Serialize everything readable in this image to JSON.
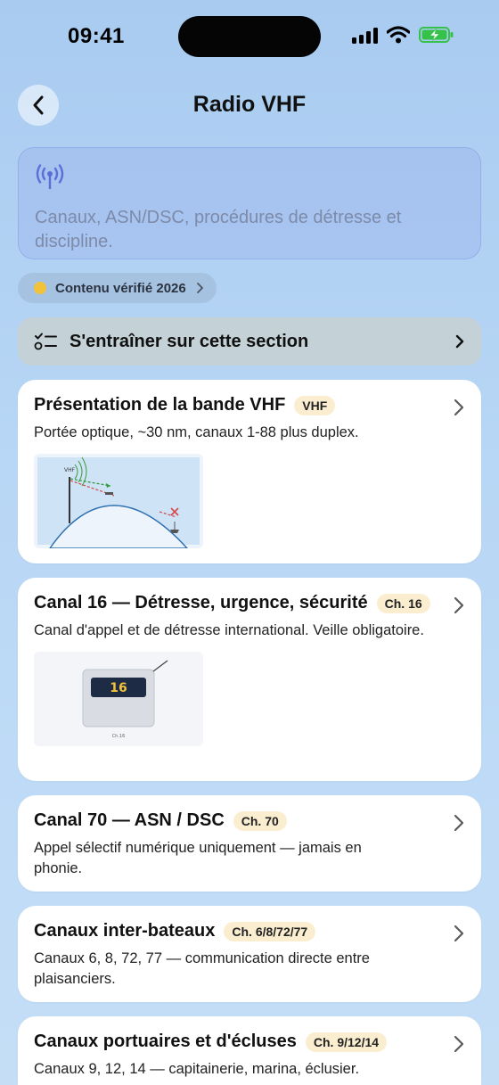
{
  "status": {
    "time": "09:41"
  },
  "nav": {
    "title": "Radio VHF"
  },
  "intro": {
    "icon": "antenna-radiowaves-icon",
    "text": "Canaux, ASN/DSC, procédures de détresse et discipline."
  },
  "verified": {
    "label": "Contenu vérifié 2026"
  },
  "train": {
    "label": "S'entraîner sur cette section"
  },
  "cards": [
    {
      "title": "Présentation de la bande VHF",
      "badge": "VHF",
      "desc": "Portée optique, ~30 nm, canaux 1-88 plus duplex.",
      "thumb": {
        "label": "VHF"
      }
    },
    {
      "title": "Canal 16 — Détresse, urgence, sécurité",
      "badge": "Ch. 16",
      "desc": "Canal d'appel et de détresse international. Veille obligatoire.",
      "thumb": {
        "display": "16",
        "caption": "Ch.16"
      }
    },
    {
      "title": "Canal 70 — ASN / DSC",
      "badge": "Ch. 70",
      "desc": "Appel sélectif numérique uniquement — jamais en phonie."
    },
    {
      "title": "Canaux inter-bateaux",
      "badge": "Ch. 6/8/72/77",
      "desc": "Canaux 6, 8, 72, 77 — communication directe entre plaisanciers."
    },
    {
      "title": "Canaux portuaires et d'écluses",
      "badge": "Ch. 9/12/14",
      "desc": "Canaux 9, 12, 14 — capitainerie, marina, éclusier."
    }
  ],
  "colors": {
    "accent": "#5b6fd6",
    "badge_bg": "#fbeed0",
    "verified_dot": "#f2c23b"
  }
}
